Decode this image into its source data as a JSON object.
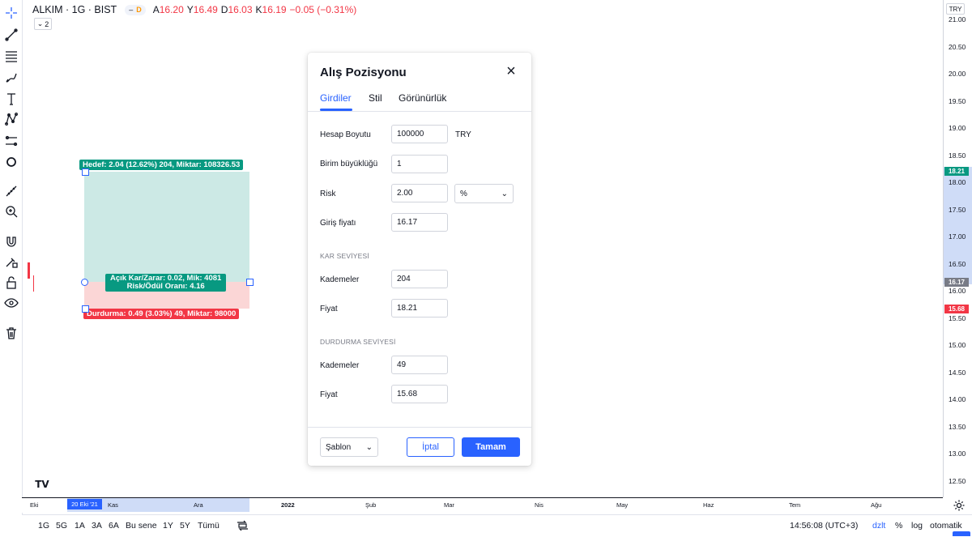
{
  "header": {
    "symbol": "ALKIM · 1G · BIST",
    "dash": "–",
    "mode": "D",
    "ohlc": [
      {
        "label": "A",
        "value": "16.20"
      },
      {
        "label": "Y",
        "value": "16.49"
      },
      {
        "label": "D",
        "value": "16.03"
      },
      {
        "label": "K",
        "value": "16.19"
      }
    ],
    "change": "−0.05 (−0.31%)",
    "collapse_count": "2"
  },
  "price_axis": {
    "currency": "TRY",
    "ticks": [
      "21.00",
      "20.50",
      "20.00",
      "19.50",
      "19.00",
      "18.50",
      "18.00",
      "17.50",
      "17.00",
      "16.50",
      "16.00",
      "15.50",
      "15.00",
      "14.50",
      "14.00",
      "13.50",
      "13.00",
      "12.50"
    ],
    "tags": [
      {
        "value": "18.21",
        "color": "#089981"
      },
      {
        "value": "16.17",
        "color": "#787b86"
      },
      {
        "value": "15.68",
        "color": "#f23645"
      }
    ]
  },
  "time_axis": {
    "labels": [
      "Eki",
      "Kas",
      "Ara",
      "2022",
      "Şub",
      "Mar",
      "Nis",
      "May",
      "Haz",
      "Tem",
      "Ağu"
    ],
    "selected_date": "20 Eki '21"
  },
  "drawing": {
    "target_label": "Hedef: 2.04 (12.62%) 204, Miktar: 108326.53",
    "pl_line1": "Açık Kar/Zarar: 0.02, Mik: 4081",
    "pl_line2": "Risk/Ödül Oranı: 4.16",
    "stop_label": "Durdurma: 0.49 (3.03%) 49, Miktar: 98000"
  },
  "bottom_bar": {
    "ranges": [
      "1G",
      "5G",
      "1A",
      "3A",
      "6A",
      "Bu sene",
      "1Y",
      "5Y",
      "Tümü"
    ],
    "time": "14:56:08 (UTC+3)",
    "adjust": "dzlt",
    "percent": "%",
    "log": "log",
    "auto": "otomatik"
  },
  "dialog": {
    "title": "Alış Pozisyonu",
    "tabs": [
      "Girdiler",
      "Stil",
      "Görünürlük"
    ],
    "account_size_label": "Hesap Boyutu",
    "account_size": "100000",
    "currency": "TRY",
    "lot_size_label": "Birim büyüklüğü",
    "lot_size": "1",
    "risk_label": "Risk",
    "risk": "2.00",
    "risk_unit": "%",
    "entry_label": "Giriş fiyatı",
    "entry": "16.17",
    "profit_section": "KAR SEVİYESİ",
    "profit_ticks_label": "Kademeler",
    "profit_ticks": "204",
    "profit_price_label": "Fiyat",
    "profit_price": "18.21",
    "stop_section": "DURDURMA SEVİYESİ",
    "stop_ticks_label": "Kademeler",
    "stop_ticks": "49",
    "stop_price_label": "Fiyat",
    "stop_price": "15.68",
    "template": "Şablon",
    "cancel": "İptal",
    "ok": "Tamam"
  },
  "colors": {
    "accent": "#2962ff",
    "profit": "#089981",
    "loss": "#f23645"
  },
  "icons": [
    "crosshair-icon",
    "trend-line-icon",
    "fib-icon",
    "brush-icon",
    "text-icon",
    "pattern-icon",
    "forecast-icon",
    "shape-icon",
    "ruler-icon",
    "zoom-icon",
    "magnet-icon",
    "lock-drawing-icon",
    "lock-icon",
    "eye-icon",
    "trash-icon",
    "settings-icon",
    "compare-icon"
  ]
}
